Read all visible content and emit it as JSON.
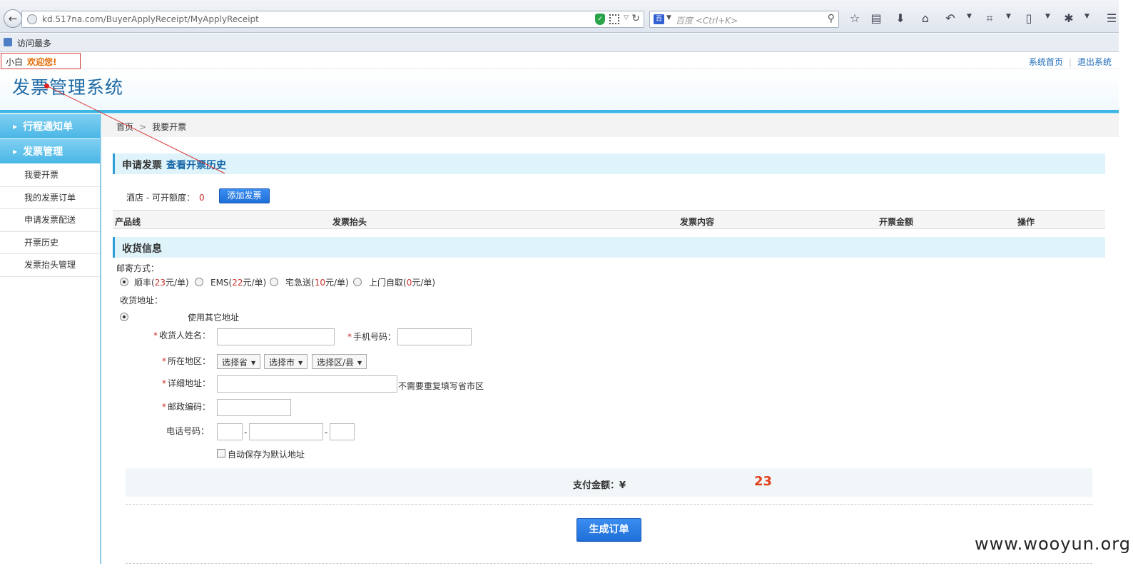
{
  "browser": {
    "url": "kd.517na.com/BuyerApplyReceipt/MyApplyReceipt",
    "search_placeholder": "百度 <Ctrl+K>",
    "bookmark_label": "访问最多"
  },
  "header": {
    "user_name": "小白",
    "welcome": "欢迎您!",
    "links": [
      "系统首页",
      "退出系统"
    ],
    "logo": "发票管理系统"
  },
  "sidebar": {
    "groups": [
      "行程通知单",
      "发票管理"
    ],
    "items": [
      "我要开票",
      "我的发票订单",
      "申请发票配送",
      "开票历史",
      "发票抬头管理"
    ]
  },
  "breadcrumb": {
    "home": "首页",
    "current": "我要开票"
  },
  "apply": {
    "title": "申请发票",
    "history_link": "查看开票历史",
    "quota_label": "酒店 - 可开额度：",
    "quota_value": "0",
    "add_button": "添加发票"
  },
  "table": {
    "columns": [
      "产品线",
      "发票抬头",
      "发票内容",
      "开票金额",
      "操作"
    ]
  },
  "shipping": {
    "title": "收货信息",
    "method_label": "邮寄方式：",
    "methods": [
      {
        "name": "顺丰(",
        "price": "23",
        "unit": "元/单)"
      },
      {
        "name": "EMS(",
        "price": "22",
        "unit": "元/单)"
      },
      {
        "name": "宅急送(",
        "price": "10",
        "unit": "元/单)"
      },
      {
        "name": "上门自取(",
        "price": "0",
        "unit": "元/单)"
      }
    ],
    "selected_method": 0,
    "address_label": "收货地址：",
    "other_address": "使用其它地址",
    "fields": {
      "receiver": "收货人姓名：",
      "phone": "手机号码：",
      "region": "所在地区：",
      "detail": "详细地址：",
      "detail_hint": "不需要重复填写省市区",
      "postcode": "邮政编码：",
      "tel": "电话号码："
    },
    "selects": [
      "选择省",
      "选择市",
      "选择区/县"
    ],
    "tel_sep": "-",
    "save_default": "自动保存为默认地址"
  },
  "payment": {
    "label": "支付金额：¥",
    "amount": "23"
  },
  "submit_button": "生成订单",
  "watermark": "www.wooyun.org",
  "colors": {
    "accent": "#3cb4e4",
    "button": "#1f6fd8",
    "price": "#e0401c"
  }
}
